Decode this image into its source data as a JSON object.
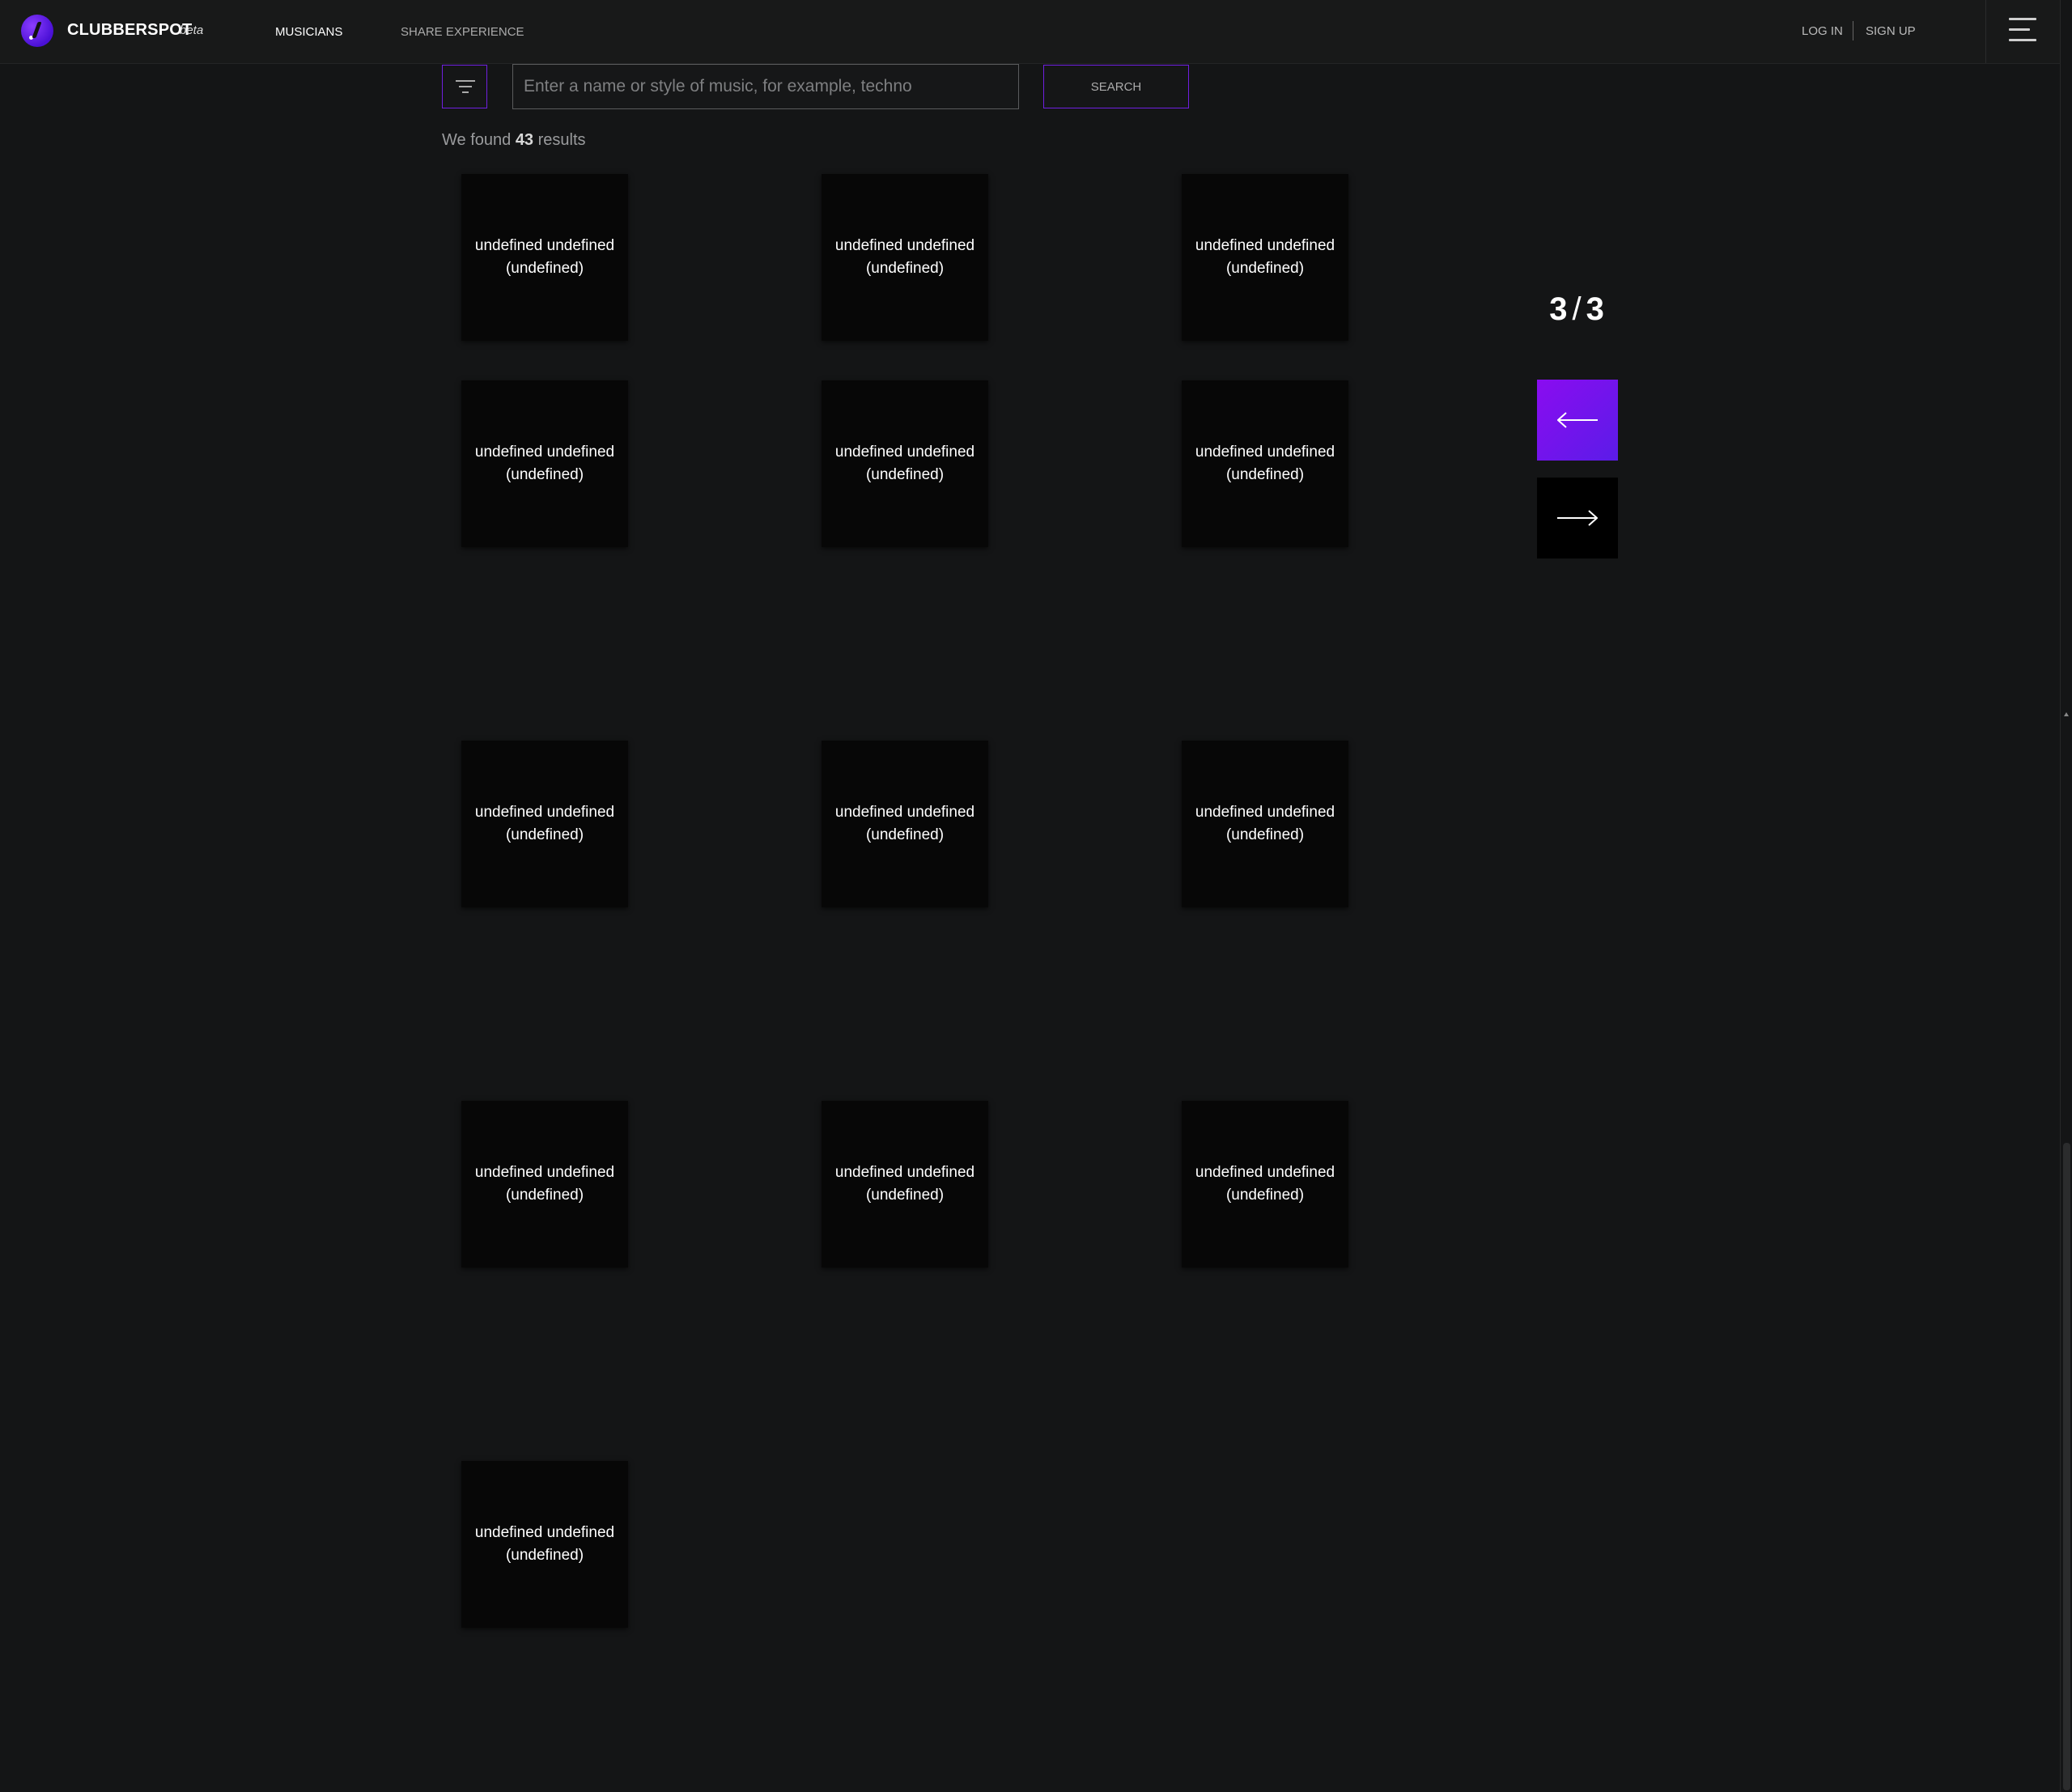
{
  "header": {
    "brand": "CLUBBERSPOT",
    "beta": "beta",
    "nav": [
      {
        "label": "MUSICIANS",
        "active": true
      },
      {
        "label": "SHARE EXPERIENCE",
        "active": false
      }
    ],
    "login": "LOG IN",
    "signup": "SIGN UP"
  },
  "search": {
    "placeholder": "Enter a name or style of music, for example, techno",
    "value": "",
    "button": "SEARCH"
  },
  "results": {
    "prefix": "We found",
    "count": "43",
    "suffix": "results"
  },
  "cards": [
    {
      "line1": "undefined undefined",
      "line2": "(undefined)"
    },
    {
      "line1": "undefined undefined",
      "line2": "(undefined)"
    },
    {
      "line1": "undefined undefined",
      "line2": "(undefined)"
    },
    {
      "line1": "undefined undefined",
      "line2": "(undefined)"
    },
    {
      "line1": "undefined undefined",
      "line2": "(undefined)"
    },
    {
      "line1": "undefined undefined",
      "line2": "(undefined)"
    },
    {
      "line1": "undefined undefined",
      "line2": "(undefined)"
    },
    {
      "line1": "undefined undefined",
      "line2": "(undefined)"
    },
    {
      "line1": "undefined undefined",
      "line2": "(undefined)"
    },
    {
      "line1": "undefined undefined",
      "line2": "(undefined)"
    },
    {
      "line1": "undefined undefined",
      "line2": "(undefined)"
    },
    {
      "line1": "undefined undefined",
      "line2": "(undefined)"
    },
    {
      "line1": "undefined undefined",
      "line2": "(undefined)"
    }
  ],
  "pagination": {
    "current": "3",
    "separator": "/",
    "total": "3"
  },
  "icons": {
    "logo": "clubberspot-logo-icon",
    "menu": "hamburger-menu-icon",
    "filter": "filter-icon",
    "prev": "arrow-left-icon",
    "next": "arrow-right-icon"
  },
  "colors": {
    "background": "#141516",
    "header": "#181919",
    "accent": "#6f1fe0",
    "card": "#070707"
  }
}
